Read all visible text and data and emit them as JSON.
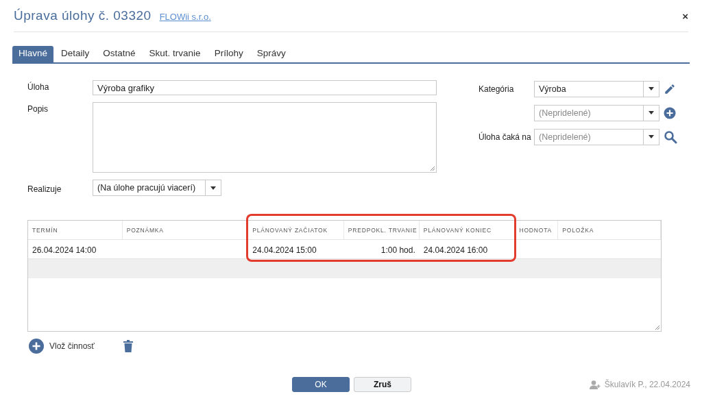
{
  "window": {
    "title": "Úprava úlohy č. 03320",
    "company_link": "FLOWii s.r.o.",
    "close": "×"
  },
  "tabs": [
    {
      "label": "Hlavné",
      "selected": true
    },
    {
      "label": "Detaily",
      "selected": false
    },
    {
      "label": "Ostatné",
      "selected": false
    },
    {
      "label": "Skut. trvanie",
      "selected": false
    },
    {
      "label": "Prílohy",
      "selected": false
    },
    {
      "label": "Správy",
      "selected": false
    }
  ],
  "form": {
    "task_label": "Úloha",
    "task_value": "Výroba grafiky",
    "description_label": "Popis",
    "realizes_label": "Realizuje",
    "realizes_value": "(Na úlohe pracujú viacerí)",
    "category_label": "Kategória",
    "category_value": "Výroba",
    "subcategory_placeholder": "(Nepridelené)",
    "waits_label": "Úloha čaká na",
    "waits_placeholder": "(Nepridelené)"
  },
  "table": {
    "columns": [
      {
        "label": "TERMÍN",
        "highlighted": false
      },
      {
        "label": "POZNÁMKA",
        "highlighted": false
      },
      {
        "label": "PLÁNOVANÝ ZAČIATOK",
        "highlighted": true
      },
      {
        "label": "PREDPOKL. TRVANIE",
        "highlighted": true
      },
      {
        "label": "PLÁNOVANÝ KONIEC",
        "highlighted": true
      },
      {
        "label": "HODNOTA",
        "highlighted": false
      },
      {
        "label": "POLOŽKA",
        "highlighted": false
      }
    ],
    "rows": [
      [
        "26.04.2024 14:00",
        "",
        "24.04.2024 15:00",
        "1:00 hod.",
        "24.04.2024 16:00",
        "",
        ""
      ]
    ]
  },
  "actions": {
    "add_label": "Vlož činnosť"
  },
  "buttons": {
    "ok": "OK",
    "cancel": "Zruš"
  },
  "footer": {
    "created": "Škulavík P., 22.04.2024"
  }
}
